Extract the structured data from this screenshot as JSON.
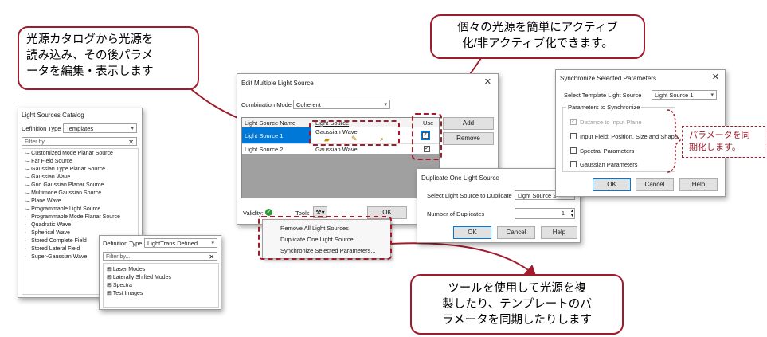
{
  "callouts": {
    "catalog": [
      "光源カタログから光源を",
      "読み込み、その後パラメ",
      "ータを編集・表示します"
    ],
    "toggle": [
      "個々の光源を簡単にアクティブ",
      "化/非アクティブ化できます。"
    ],
    "tools": [
      "ツールを使用して光源を複",
      "製したり、テンプレートのパ",
      "ラメータを同期したりします"
    ],
    "sync_note": [
      "パラメータを同",
      "期化します。"
    ]
  },
  "catalog": {
    "title": "Light Sources Catalog",
    "def_type_label": "Definition Type",
    "def_type_value": "Templates",
    "filter_placeholder": "Filter by...",
    "items": [
      "Customized Mode Planar Source",
      "Far Field Source",
      "Gaussian Type Planar Source",
      "Gaussian Wave",
      "Grid Gaussian Planar Source",
      "Multimode Gaussian Source",
      "Plane Wave",
      "Programmable Light Source",
      "Programmable Mode Planar Source",
      "Quadratic Wave",
      "Spherical Wave",
      "Stored Complete Field",
      "Stored Lateral Field",
      "Super-Gaussian Wave"
    ]
  },
  "catalog2": {
    "def_type_label": "Definition Type",
    "def_type_value": "LightTrans Defined",
    "filter_placeholder": "Filter by...",
    "items": [
      "Laser Modes",
      "Laterally Shifted Modes",
      "Spectra",
      "Test Images"
    ]
  },
  "edit_dialog": {
    "title": "Edit Multiple Light Source",
    "combination_label": "Combination Mode",
    "combination_value": "Coherent",
    "col_name": "Light Source Name",
    "col_source": "Light Source",
    "col_use": "Use",
    "rows": [
      {
        "name": "Light Source 1",
        "source": "Gaussian Wave",
        "use": true
      },
      {
        "name": "Light Source 2",
        "source": "Gaussian Wave",
        "use": true
      }
    ],
    "add_label": "Add",
    "remove_label": "Remove",
    "validity_label": "Validity:",
    "tools_label": "Tools",
    "ok_label": "OK"
  },
  "tools_menu": [
    "Remove All Light Sources",
    "Duplicate One Light Source...",
    "Synchronize Selected Parameters..."
  ],
  "duplicate_dialog": {
    "title": "Duplicate One Light Source",
    "select_label": "Select Light Source to Duplicate",
    "select_value": "Light Source 2",
    "number_label": "Number of Duplicates",
    "number_value": "1",
    "ok_label": "OK",
    "cancel_label": "Cancel",
    "help_label": "Help"
  },
  "sync_dialog": {
    "title": "Synchronize Selected Parameters",
    "template_label": "Select Template Light Source",
    "template_value": "Light Source 1",
    "group_label": "Parameters to Synchronize",
    "params": [
      {
        "label": "Distance to Input Plane",
        "checked": true,
        "disabled": true
      },
      {
        "label": "Input Field: Position, Size and Shape",
        "checked": false,
        "disabled": false
      },
      {
        "label": "Spectral Parameters",
        "checked": false,
        "disabled": false
      },
      {
        "label": "Gaussian Parameters",
        "checked": false,
        "disabled": false
      }
    ],
    "ok_label": "OK",
    "cancel_label": "Cancel",
    "help_label": "Help"
  },
  "colors": {
    "accent_red": "#a01c2c",
    "selection_blue": "#0078d7",
    "grid_gray": "#a0a0a0",
    "valid_green": "#2e9a3a"
  }
}
